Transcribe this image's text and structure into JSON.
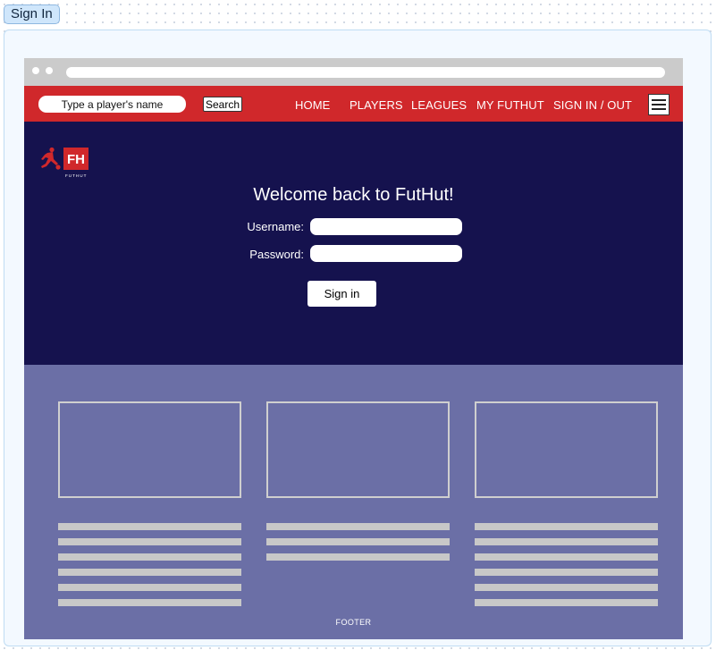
{
  "frame": {
    "tab_label": "Sign In"
  },
  "nav": {
    "search_placeholder": "Type a player's name",
    "search_button": "Search",
    "links": [
      "HOME",
      "PLAYERS",
      "LEAGUES",
      "MY FUTHUT",
      "SIGN IN / OUT"
    ],
    "menu_icon": "hamburger-menu-icon"
  },
  "logo": {
    "mark": "FH",
    "caption": "FUTHUT",
    "icon": "footballer-icon"
  },
  "hero": {
    "title": "Welcome back to FutHut!",
    "username_label": "Username:",
    "password_label": "Password:",
    "username_value": "",
    "password_value": "",
    "sign_in_button": "Sign in"
  },
  "footer": {
    "label": "FOOTER"
  },
  "colors": {
    "navbar": "#d0282b",
    "hero": "#15124e",
    "footer": "#6b6fa6",
    "placeholder": "#c8c8c8"
  }
}
